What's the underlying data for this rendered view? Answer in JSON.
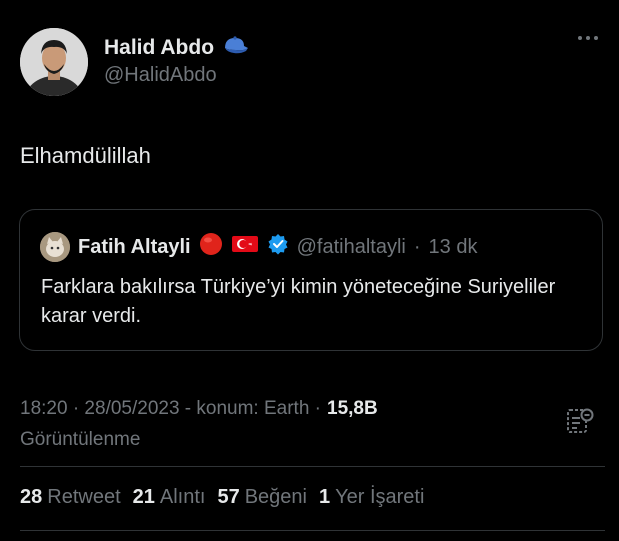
{
  "author": {
    "display_name": "Halid Abdo",
    "handle": "@HalidAbdo",
    "badge_icon": "blue-cap-icon"
  },
  "tweet": {
    "text": "Elhamdülillah"
  },
  "quoted": {
    "display_name": "Fatih Altayli",
    "emoji_1": "red-circle-icon",
    "emoji_2": "turkey-flag-icon",
    "verified_icon": "verified-badge-icon",
    "handle": "@fatihaltayli",
    "separator": "·",
    "time": "13 dk",
    "text": "Farklara bakılırsa Türkiye’yi kimin yöneteceğine Suriyeliler karar verdi."
  },
  "meta": {
    "timestamp": "18:20 · 28/05/2023 - konum: Earth ·",
    "views_count": "15,8B",
    "views_label": "Görüntülenme"
  },
  "stats": {
    "retweet_count": "28",
    "retweet_label": "Retweet",
    "quote_count": "21",
    "quote_label": "Alıntı",
    "like_count": "57",
    "like_label": "Beğeni",
    "bookmark_count": "1",
    "bookmark_label": "Yer İşareti"
  },
  "colors": {
    "background": "#000000",
    "primary_text": "#e7e9ea",
    "secondary_text": "#71767b",
    "border": "#2f3336",
    "verified": "#1d9bf0"
  }
}
